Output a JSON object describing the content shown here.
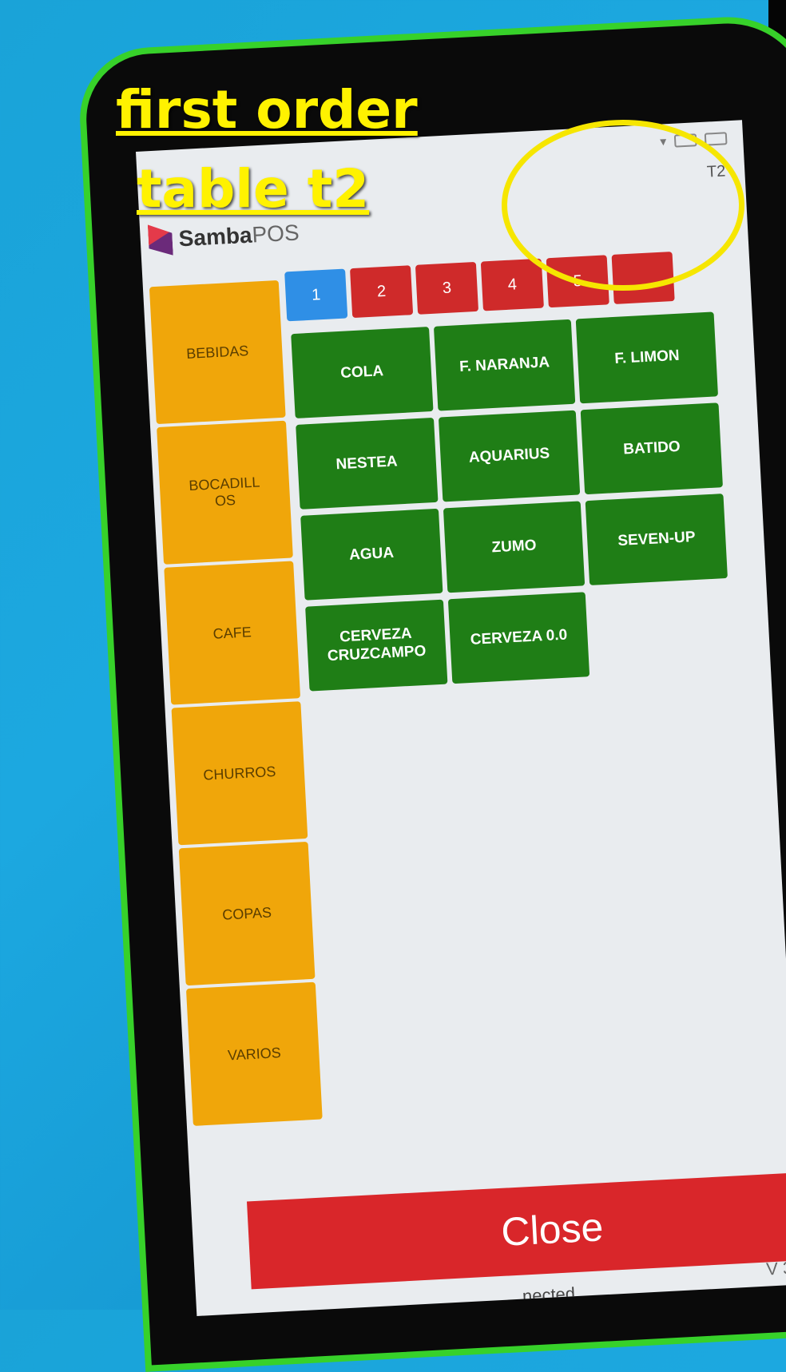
{
  "annotation": {
    "line1": "first order",
    "line2": "table t2"
  },
  "header": {
    "table_label": "T2",
    "brand_bold": "Samba",
    "brand_light": "POS"
  },
  "page_tabs": [
    {
      "label": "1",
      "active": true
    },
    {
      "label": "2",
      "active": false
    },
    {
      "label": "3",
      "active": false
    },
    {
      "label": "4",
      "active": false
    },
    {
      "label": "5",
      "active": false
    },
    {
      "label": "",
      "active": false
    }
  ],
  "categories": [
    "BEBIDAS",
    "BOCADILL\nOS",
    "CAFE",
    "CHURROS",
    "COPAS",
    "VARIOS"
  ],
  "products": [
    "COLA",
    "F. NARANJA",
    "F. LIMON",
    "NESTEA",
    "AQUARIUS",
    "BATIDO",
    "AGUA",
    "ZUMO",
    "SEVEN-UP",
    "CERVEZA\nCRUZCAMPO",
    "CERVEZA 0.0"
  ],
  "footer": {
    "close_label": "Close",
    "status_text": "...nected",
    "version_text": "V 3"
  },
  "colors": {
    "category": "#f0a60a",
    "product": "#1f7e16",
    "page_active": "#2f8fe6",
    "page_inactive": "#cf2a2a",
    "close": "#d9262a"
  }
}
